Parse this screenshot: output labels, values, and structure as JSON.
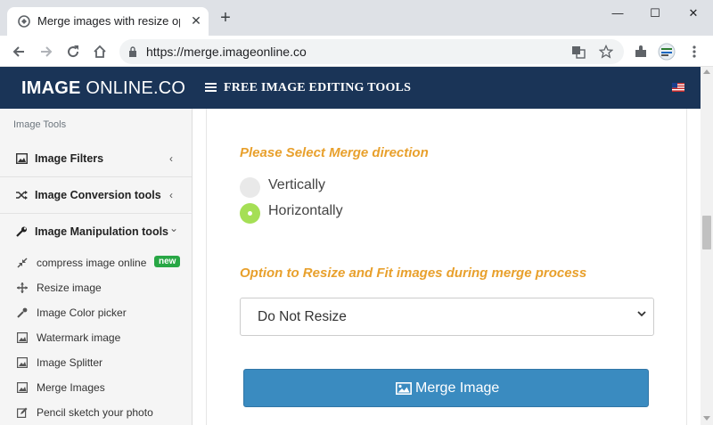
{
  "browser": {
    "tab_title": "Merge images with resize optio",
    "tab_close": "✕",
    "new_tab": "+",
    "url": "https://merge.imageonline.co",
    "win_minimize": "—",
    "win_maximize": "☐",
    "win_close": "✕"
  },
  "header": {
    "logo_bold": "IMAGE",
    "logo_rest": " ONLINE.CO",
    "title": "FREE IMAGE EDITING TOOLS"
  },
  "sidebar": {
    "section": "Image Tools",
    "groups": [
      {
        "label": "Image Filters",
        "chevron": "‹"
      },
      {
        "label": "Image Conversion tools",
        "chevron": "‹"
      },
      {
        "label": "Image Manipulation tools",
        "chevron": "⌄"
      }
    ],
    "items": [
      {
        "label": "compress image online",
        "badge": "new"
      },
      {
        "label": "Resize image"
      },
      {
        "label": "Image Color picker"
      },
      {
        "label": "Watermark image"
      },
      {
        "label": "Image Splitter"
      },
      {
        "label": "Merge Images"
      },
      {
        "label": "Pencil sketch your photo"
      }
    ]
  },
  "main": {
    "direction_title": "Please Select Merge direction",
    "direction_options": [
      {
        "label": "Vertically",
        "checked": false
      },
      {
        "label": "Horizontally",
        "checked": true
      }
    ],
    "resize_title": "Option to Resize and Fit images during merge process",
    "resize_value": "Do Not Resize",
    "merge_button": "Merge Image"
  },
  "colors": {
    "header_bg": "#1a3457",
    "accent_orange": "#e8a02c",
    "radio_checked": "#a5df55",
    "button_blue": "#3a8bc0",
    "badge_green": "#28a745"
  }
}
